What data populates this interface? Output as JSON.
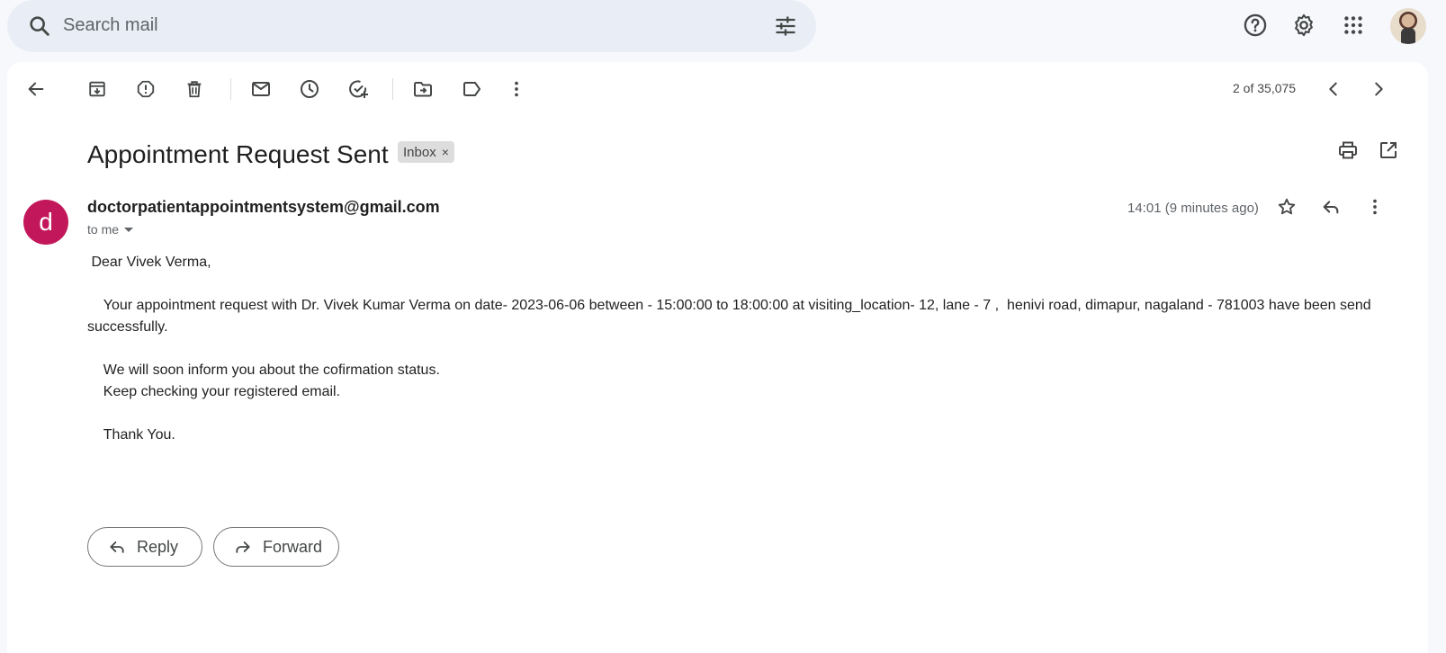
{
  "search": {
    "placeholder": "Search mail"
  },
  "top_icons": [
    "search-icon",
    "tune-icon",
    "help-icon",
    "settings-icon",
    "apps-icon"
  ],
  "toolbar": {
    "pager_text": "2 of 35,075",
    "icons": [
      "back-arrow-icon",
      "archive-icon",
      "report-spam-icon",
      "delete-icon",
      "mark-unread-icon",
      "snooze-icon",
      "add-to-tasks-icon",
      "move-to-icon",
      "label-icon",
      "more-vert-icon",
      "newer-chevron-icon",
      "older-chevron-icon"
    ]
  },
  "email": {
    "subject": "Appointment Request Sent",
    "label": "Inbox",
    "label_remove": "×",
    "sender_initial": "d",
    "sender": "doctorpatientappointmentsystem@gmail.com",
    "recipient": "to me",
    "time": "14:01 (9 minutes ago)",
    "greeting": " Dear Vivek Verma,",
    "paragraph1": "    Your appointment request with Dr. Vivek Kumar Verma on date- 2023-06-06 between - 15:00:00 to 18:00:00 at visiting_location- 12, lane - 7 ,  henivi road, dimapur, nagaland - 781003 have been send successfully.",
    "line2": "    We will soon inform you about the cofirmation status.",
    "line3": "    Keep checking your registered email.",
    "closing": "    Thank You."
  },
  "actions": {
    "reply_label": "Reply",
    "forward_label": "Forward"
  },
  "colors": {
    "avatar_bg": "#c2185b",
    "search_bg": "#e9eef6",
    "page_bg": "#f6f8fc"
  }
}
